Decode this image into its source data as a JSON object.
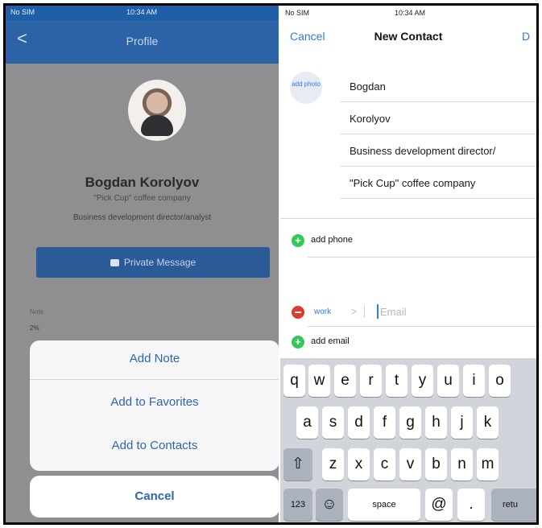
{
  "left": {
    "status": {
      "carrier": "No SIM",
      "time": "10:34 AM"
    },
    "nav": {
      "back": "<",
      "title": "Profile"
    },
    "profile": {
      "name": "Bogdan Korolyov",
      "company": "\"Pick Cup\" coffee company",
      "position": "Business development director/analyst"
    },
    "private_message": "Private Message",
    "small1": "Note",
    "small2": "2%",
    "sheet": {
      "items": [
        "Add Note",
        "Add to Favorites",
        "Add to Contacts"
      ],
      "cancel": "Cancel"
    }
  },
  "right": {
    "status": {
      "carrier": "No SIM",
      "time": "10:34 AM"
    },
    "nav": {
      "cancel": "Cancel",
      "title": "New Contact",
      "done": "D"
    },
    "add_photo": "add photo",
    "fields": {
      "first": "Bogdan",
      "last": "Korolyov",
      "position": "Business development director/",
      "company": "\"Pick Cup\" coffee company"
    },
    "add_phone": "add phone",
    "email_type": "work",
    "email_chevron": ">",
    "email_placeholder": "Email",
    "add_email": "add email",
    "keyboard": {
      "row1": [
        "q",
        "w",
        "e",
        "r",
        "t",
        "y",
        "u",
        "i",
        "o"
      ],
      "row2": [
        "a",
        "s",
        "d",
        "f",
        "g",
        "h",
        "j",
        "k"
      ],
      "row3": [
        "z",
        "x",
        "c",
        "v",
        "b",
        "n",
        "m"
      ],
      "shift": "⇧",
      "numbers": "123",
      "emoji": "☺",
      "space": "space",
      "at": "@",
      "dot": ".",
      "return": "retu"
    }
  },
  "colors": {
    "brand_blue": "#2b63a6",
    "ios_blue": "#2f7be0",
    "sheet_blue": "#2f64b0"
  }
}
